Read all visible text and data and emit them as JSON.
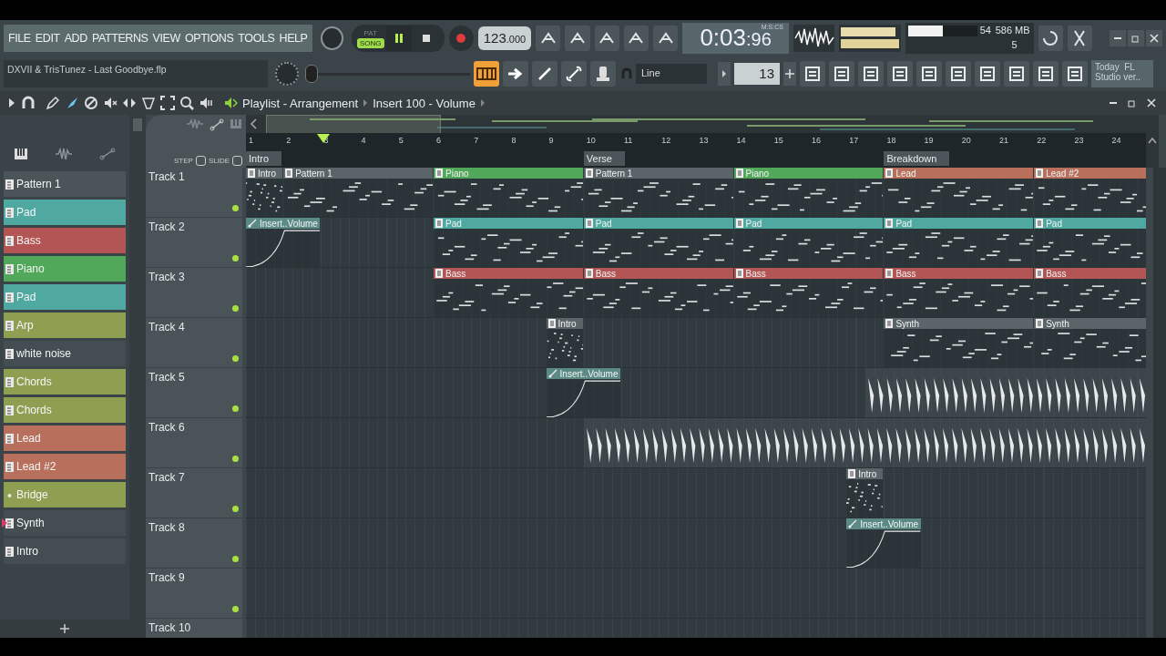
{
  "menu": [
    "FILE",
    "EDIT",
    "ADD",
    "PATTERNS",
    "VIEW",
    "OPTIONS",
    "TOOLS",
    "HELP"
  ],
  "project_title": "DXVII & TrisTunez - Last Goodbye.flp",
  "transport": {
    "modes": [
      {
        "label": "PAT",
        "selected": false
      },
      {
        "label": "SONG",
        "selected": true
      }
    ],
    "playing": true,
    "tempo": "123",
    "tempo_fraction": ".000"
  },
  "master_slider": {
    "level": 0.03
  },
  "time": {
    "format": "M:S:CS",
    "value": "0:03",
    "centiseconds": ":96"
  },
  "monitor": {
    "cpu": "54",
    "cpu_meter": {
      "level": 0.5
    },
    "memory": "586 MB",
    "polyphony": "5"
  },
  "snap": "Line",
  "pattern_number": "13",
  "news": [
    "Today  FL",
    "Studio ver.."
  ],
  "playlist": {
    "title": "Playlist - Arrangement",
    "target": "Insert 100 - Volume",
    "step_label": "STEP",
    "slide_label": "SLIDE",
    "ruler": [
      "1",
      "2",
      "3",
      "4",
      "5",
      "6",
      "7",
      "8",
      "9",
      "10",
      "11",
      "12",
      "13",
      "14",
      "15",
      "16",
      "17",
      "18",
      "19",
      "20",
      "21",
      "22",
      "23",
      "24"
    ],
    "position": {
      "level": 0.086
    },
    "markers": [
      {
        "label": "Intro"
      },
      {
        "label": "Verse"
      },
      {
        "label": "Breakdown"
      }
    ],
    "tracks": [
      {
        "name": "Track 1",
        "clips": [
          {
            "kind": "pattern",
            "label": "Intro",
            "color": "#5b6569"
          },
          {
            "kind": "pattern",
            "label": "Pattern 1",
            "color": "#5b6569"
          },
          {
            "kind": "pattern",
            "label": "Piano",
            "color": "#52a85a"
          },
          {
            "kind": "pattern",
            "label": "Pattern 1",
            "color": "#5b6569"
          },
          {
            "kind": "pattern",
            "label": "Piano",
            "color": "#52a85a"
          },
          {
            "kind": "pattern",
            "label": "Lead",
            "color": "#b8705c"
          },
          {
            "kind": "pattern",
            "label": "Lead #2",
            "color": "#b8705c"
          }
        ]
      },
      {
        "name": "Track 2",
        "clips": [
          {
            "kind": "automation",
            "label": "Insert..Volume",
            "color": "#5b8a85"
          },
          {
            "kind": "pattern",
            "label": "Pad",
            "color": "#4fa9a0"
          },
          {
            "kind": "pattern",
            "label": "Pad",
            "color": "#4fa9a0"
          },
          {
            "kind": "pattern",
            "label": "Pad",
            "color": "#4fa9a0"
          },
          {
            "kind": "pattern",
            "label": "Pad",
            "color": "#4fa9a0"
          },
          {
            "kind": "pattern",
            "label": "Pad",
            "color": "#4fa9a0"
          }
        ]
      },
      {
        "name": "Track 3",
        "clips": [
          {
            "kind": "pattern",
            "label": "Bass",
            "color": "#b45555"
          },
          {
            "kind": "pattern",
            "label": "Bass",
            "color": "#b45555"
          },
          {
            "kind": "pattern",
            "label": "Bass",
            "color": "#b45555"
          },
          {
            "kind": "pattern",
            "label": "Bass",
            "color": "#b45555"
          },
          {
            "kind": "pattern",
            "label": "Bass",
            "color": "#b45555"
          }
        ]
      },
      {
        "name": "Track 4",
        "clips": [
          {
            "kind": "pattern",
            "label": "Intro",
            "color": "#5b6569"
          },
          {
            "kind": "pattern",
            "label": "Synth",
            "color": "#5b6569"
          },
          {
            "kind": "pattern",
            "label": "Synth",
            "color": "#5b6569"
          }
        ]
      },
      {
        "name": "Track 5",
        "clips": [
          {
            "kind": "automation",
            "label": "Insert..Volume",
            "color": "#5b8a85"
          },
          {
            "kind": "audio"
          }
        ]
      },
      {
        "name": "Track 6",
        "clips": [
          {
            "kind": "audio"
          }
        ]
      },
      {
        "name": "Track 7",
        "clips": [
          {
            "kind": "pattern",
            "label": "Intro",
            "color": "#5b6569"
          }
        ]
      },
      {
        "name": "Track 8",
        "clips": [
          {
            "kind": "automation",
            "label": "Insert..Volume",
            "color": "#5b8a85"
          }
        ]
      },
      {
        "name": "Track 9"
      },
      {
        "name": "Track 10"
      }
    ]
  },
  "patterns": [
    {
      "label": "Pattern 1",
      "kind": "pattern",
      "color": "#4a5459",
      "selected": false
    },
    {
      "label": "Pad",
      "kind": "pattern",
      "color": "#4fa9a0",
      "selected": false
    },
    {
      "label": "Bass",
      "kind": "pattern",
      "color": "#b45555",
      "selected": false
    },
    {
      "label": "Piano",
      "kind": "pattern",
      "color": "#52a85a",
      "selected": false
    },
    {
      "label": "Pad",
      "kind": "pattern",
      "color": "#4fa9a0",
      "selected": false
    },
    {
      "label": "Arp",
      "kind": "pattern",
      "color": "#8f9f52",
      "selected": false
    },
    {
      "label": "white noise",
      "kind": "pattern",
      "color": "#434d52",
      "selected": false
    },
    {
      "label": "Chords",
      "kind": "pattern",
      "color": "#8f9f52",
      "selected": false
    },
    {
      "label": "Chords",
      "kind": "pattern",
      "color": "#8f9f52",
      "selected": false
    },
    {
      "label": "Lead",
      "kind": "pattern",
      "color": "#b8705c",
      "selected": false
    },
    {
      "label": "Lead #2",
      "kind": "pattern",
      "color": "#b8705c",
      "selected": false
    },
    {
      "label": "Bridge",
      "kind": "dot",
      "color": "#8f9f52",
      "selected": false
    },
    {
      "label": "Synth",
      "kind": "pattern",
      "color": "#434d52",
      "selected": true
    },
    {
      "label": "Intro",
      "kind": "pattern",
      "color": "#434d52",
      "selected": false
    }
  ]
}
